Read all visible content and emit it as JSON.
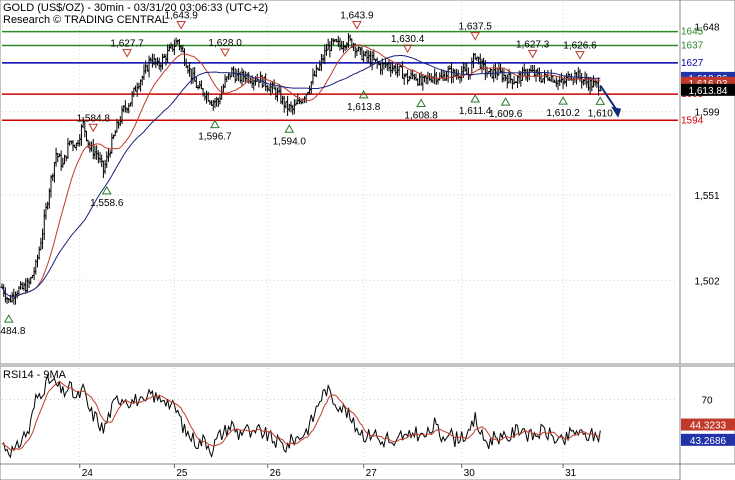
{
  "header": {
    "line1": "GOLD (US$/OZ) - 30min - 03/31/20 03:06:33 (UTC+2)",
    "line2": "Research © TRADING CENTRAL"
  },
  "rsi_title": "RSI14 - 9MA",
  "colors": {
    "green_level": "#2a8a2a",
    "blue_level": "#0000b0",
    "red_level": "#d00000",
    "ma_fast": "#c0392b",
    "ma_slow": "#1a237e",
    "rsi": "#000000",
    "rsi_ma": "#c0392b",
    "marker": "#2a7a2a",
    "forecast_arrow": "#102a7a"
  },
  "chart_data": [
    {
      "type": "candlestick",
      "title": "GOLD (US$/OZ) - 30min",
      "ylim": [
        1455,
        1662
      ],
      "y_ticks": [
        1502,
        1551,
        1599,
        1648
      ],
      "x_day_labels": [
        "24",
        "25",
        "26",
        "27",
        "30",
        "31"
      ],
      "price_tags": [
        {
          "text": "1,618.36",
          "value": 1618.36,
          "bg": "#2233aa",
          "fg": "#ffffff"
        },
        {
          "text": "1,616.93",
          "value": 1615.5,
          "bg": "#c0392b",
          "fg": "#ffffff"
        },
        {
          "text": "1,613.84",
          "value": 1611.5,
          "bg": "#000000",
          "fg": "#ffffff"
        }
      ],
      "levels": [
        {
          "value": 1645,
          "label": "1645",
          "color": "green"
        },
        {
          "value": 1637,
          "label": "1637",
          "color": "green"
        },
        {
          "value": 1627,
          "label": "1627",
          "color": "blue"
        },
        {
          "value": 1609,
          "label": "1609",
          "color": "red"
        },
        {
          "value": 1594,
          "label": "1594",
          "color": "red"
        }
      ],
      "annotations": [
        {
          "text": "1,484.8",
          "kind": "low",
          "x_frac": 0.01,
          "value": 1484.8
        },
        {
          "text": "1,558.6",
          "kind": "low",
          "x_frac": 0.155,
          "value": 1558.6
        },
        {
          "text": "1,584.8",
          "kind": "high",
          "x_frac": 0.135,
          "value": 1584.8
        },
        {
          "text": "1,627.7",
          "kind": "high",
          "x_frac": 0.185,
          "value": 1627.7
        },
        {
          "text": "1,643.9",
          "kind": "high",
          "x_frac": 0.265,
          "value": 1643.9
        },
        {
          "text": "1,628.0",
          "kind": "high",
          "x_frac": 0.33,
          "value": 1628.0
        },
        {
          "text": "1,596.7",
          "kind": "low",
          "x_frac": 0.315,
          "value": 1596.7
        },
        {
          "text": "1,594.0",
          "kind": "low",
          "x_frac": 0.425,
          "value": 1594.0
        },
        {
          "text": "1,643.9",
          "kind": "high",
          "x_frac": 0.525,
          "value": 1643.9
        },
        {
          "text": "1,613.8",
          "kind": "low",
          "x_frac": 0.535,
          "value": 1613.8
        },
        {
          "text": "1,630.4",
          "kind": "high",
          "x_frac": 0.6,
          "value": 1630.4
        },
        {
          "text": "1,608.8",
          "kind": "low",
          "x_frac": 0.62,
          "value": 1608.8
        },
        {
          "text": "1,637.5",
          "kind": "high",
          "x_frac": 0.7,
          "value": 1637.5
        },
        {
          "text": "1,611.4",
          "kind": "low",
          "x_frac": 0.7,
          "value": 1611.4
        },
        {
          "text": "1,609.6",
          "kind": "low",
          "x_frac": 0.745,
          "value": 1609.6
        },
        {
          "text": "1,627.3",
          "kind": "high",
          "x_frac": 0.785,
          "value": 1627.3
        },
        {
          "text": "1,610.2",
          "kind": "low",
          "x_frac": 0.83,
          "value": 1610.2
        },
        {
          "text": "1,626.6",
          "kind": "high",
          "x_frac": 0.855,
          "value": 1626.6
        },
        {
          "text": "1,610",
          "kind": "low",
          "x_frac": 0.885,
          "value": 1610.0
        }
      ],
      "path_points": [
        [
          0.0,
          1498
        ],
        [
          0.01,
          1490
        ],
        [
          0.02,
          1496
        ],
        [
          0.03,
          1497
        ],
        [
          0.04,
          1500
        ],
        [
          0.05,
          1510
        ],
        [
          0.06,
          1530
        ],
        [
          0.07,
          1555
        ],
        [
          0.08,
          1575
        ],
        [
          0.09,
          1568
        ],
        [
          0.1,
          1582
        ],
        [
          0.11,
          1580
        ],
        [
          0.12,
          1592
        ],
        [
          0.13,
          1578
        ],
        [
          0.14,
          1575
        ],
        [
          0.15,
          1565
        ],
        [
          0.16,
          1578
        ],
        [
          0.17,
          1590
        ],
        [
          0.18,
          1600
        ],
        [
          0.19,
          1605
        ],
        [
          0.2,
          1615
        ],
        [
          0.21,
          1620
        ],
        [
          0.22,
          1630
        ],
        [
          0.23,
          1625
        ],
        [
          0.24,
          1630
        ],
        [
          0.25,
          1635
        ],
        [
          0.26,
          1640
        ],
        [
          0.27,
          1630
        ],
        [
          0.28,
          1620
        ],
        [
          0.29,
          1612
        ],
        [
          0.3,
          1610
        ],
        [
          0.31,
          1605
        ],
        [
          0.32,
          1605
        ],
        [
          0.33,
          1616
        ],
        [
          0.34,
          1622
        ],
        [
          0.35,
          1618
        ],
        [
          0.36,
          1620
        ],
        [
          0.37,
          1618
        ],
        [
          0.38,
          1618
        ],
        [
          0.39,
          1615
        ],
        [
          0.4,
          1612
        ],
        [
          0.41,
          1608
        ],
        [
          0.42,
          1602
        ],
        [
          0.43,
          1600
        ],
        [
          0.44,
          1605
        ],
        [
          0.45,
          1610
        ],
        [
          0.46,
          1618
        ],
        [
          0.47,
          1625
        ],
        [
          0.48,
          1635
        ],
        [
          0.49,
          1638
        ],
        [
          0.5,
          1637
        ],
        [
          0.51,
          1640
        ],
        [
          0.52,
          1638
        ],
        [
          0.53,
          1632
        ],
        [
          0.54,
          1630
        ],
        [
          0.55,
          1628
        ],
        [
          0.56,
          1625
        ],
        [
          0.57,
          1626
        ],
        [
          0.58,
          1624
        ],
        [
          0.59,
          1622
        ],
        [
          0.6,
          1618
        ],
        [
          0.61,
          1620
        ],
        [
          0.62,
          1615
        ],
        [
          0.63,
          1618
        ],
        [
          0.64,
          1620
        ],
        [
          0.65,
          1618
        ],
        [
          0.66,
          1622
        ],
        [
          0.67,
          1620
        ],
        [
          0.68,
          1622
        ],
        [
          0.69,
          1620
        ],
        [
          0.7,
          1632
        ],
        [
          0.71,
          1625
        ],
        [
          0.72,
          1620
        ],
        [
          0.73,
          1622
        ],
        [
          0.74,
          1620
        ],
        [
          0.75,
          1618
        ],
        [
          0.76,
          1617
        ],
        [
          0.77,
          1620
        ],
        [
          0.78,
          1622
        ],
        [
          0.79,
          1620
        ],
        [
          0.8,
          1618
        ],
        [
          0.81,
          1620
        ],
        [
          0.82,
          1617
        ],
        [
          0.83,
          1615
        ],
        [
          0.84,
          1620
        ],
        [
          0.85,
          1620
        ],
        [
          0.86,
          1617
        ],
        [
          0.87,
          1615
        ],
        [
          0.88,
          1614
        ],
        [
          0.885,
          1614
        ]
      ],
      "forecast": [
        [
          0.885,
          1614
        ],
        [
          0.91,
          1596
        ]
      ]
    },
    {
      "type": "line",
      "title": "RSI14 - 9MA",
      "ylim": [
        20,
        95
      ],
      "y_ticks": [
        70
      ],
      "value_tags": [
        {
          "text": "44.3233",
          "value": 44.3233,
          "bg": "#c0392b",
          "fg": "#ffffff"
        },
        {
          "text": "43.2686",
          "value": 43.2686,
          "bg": "#2233aa",
          "fg": "#ffffff"
        }
      ],
      "rsi_points": [
        [
          0.0,
          35
        ],
        [
          0.01,
          30
        ],
        [
          0.02,
          28
        ],
        [
          0.03,
          40
        ],
        [
          0.04,
          45
        ],
        [
          0.05,
          70
        ],
        [
          0.06,
          78
        ],
        [
          0.07,
          85
        ],
        [
          0.08,
          82
        ],
        [
          0.09,
          75
        ],
        [
          0.1,
          80
        ],
        [
          0.11,
          70
        ],
        [
          0.12,
          78
        ],
        [
          0.13,
          60
        ],
        [
          0.14,
          55
        ],
        [
          0.15,
          45
        ],
        [
          0.16,
          60
        ],
        [
          0.17,
          70
        ],
        [
          0.18,
          72
        ],
        [
          0.19,
          68
        ],
        [
          0.2,
          70
        ],
        [
          0.21,
          65
        ],
        [
          0.22,
          75
        ],
        [
          0.23,
          70
        ],
        [
          0.24,
          72
        ],
        [
          0.25,
          65
        ],
        [
          0.26,
          60
        ],
        [
          0.27,
          45
        ],
        [
          0.28,
          40
        ],
        [
          0.29,
          35
        ],
        [
          0.3,
          38
        ],
        [
          0.31,
          30
        ],
        [
          0.32,
          40
        ],
        [
          0.33,
          45
        ],
        [
          0.34,
          50
        ],
        [
          0.35,
          42
        ],
        [
          0.36,
          48
        ],
        [
          0.37,
          40
        ],
        [
          0.38,
          45
        ],
        [
          0.39,
          42
        ],
        [
          0.4,
          38
        ],
        [
          0.41,
          35
        ],
        [
          0.42,
          32
        ],
        [
          0.43,
          38
        ],
        [
          0.44,
          40
        ],
        [
          0.45,
          45
        ],
        [
          0.46,
          55
        ],
        [
          0.47,
          70
        ],
        [
          0.48,
          78
        ],
        [
          0.49,
          70
        ],
        [
          0.5,
          65
        ],
        [
          0.51,
          60
        ],
        [
          0.52,
          50
        ],
        [
          0.53,
          45
        ],
        [
          0.54,
          40
        ],
        [
          0.55,
          45
        ],
        [
          0.56,
          35
        ],
        [
          0.57,
          40
        ],
        [
          0.58,
          30
        ],
        [
          0.59,
          42
        ],
        [
          0.6,
          38
        ],
        [
          0.61,
          45
        ],
        [
          0.62,
          40
        ],
        [
          0.63,
          42
        ],
        [
          0.64,
          50
        ],
        [
          0.65,
          40
        ],
        [
          0.66,
          45
        ],
        [
          0.67,
          38
        ],
        [
          0.68,
          42
        ],
        [
          0.69,
          40
        ],
        [
          0.7,
          55
        ],
        [
          0.71,
          40
        ],
        [
          0.72,
          35
        ],
        [
          0.73,
          42
        ],
        [
          0.74,
          38
        ],
        [
          0.75,
          40
        ],
        [
          0.76,
          45
        ],
        [
          0.77,
          48
        ],
        [
          0.78,
          40
        ],
        [
          0.79,
          42
        ],
        [
          0.8,
          45
        ],
        [
          0.81,
          42
        ],
        [
          0.82,
          38
        ],
        [
          0.83,
          35
        ],
        [
          0.84,
          42
        ],
        [
          0.85,
          45
        ],
        [
          0.86,
          40
        ],
        [
          0.87,
          42
        ],
        [
          0.88,
          40
        ],
        [
          0.885,
          43
        ]
      ]
    }
  ]
}
